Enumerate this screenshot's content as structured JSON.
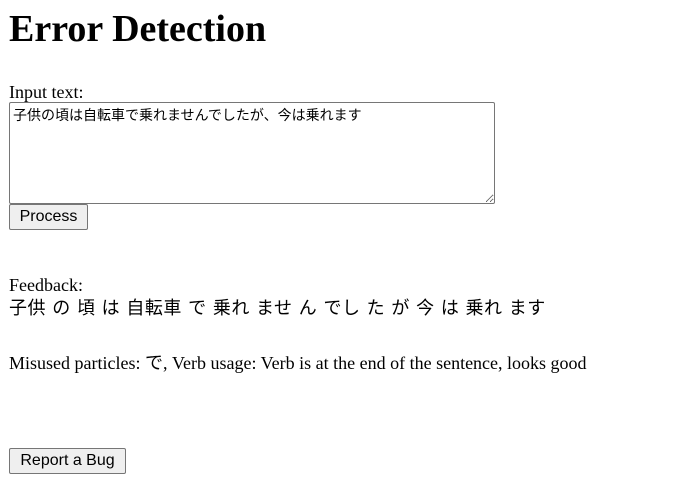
{
  "page": {
    "title": "Error Detection"
  },
  "form": {
    "input_label": "Input text:",
    "input_value": "子供の頃は自転車で乗れませんでしたが、今は乗れます",
    "process_button": "Process"
  },
  "feedback": {
    "label": "Feedback:",
    "tokens": "子供 の 頃 は 自転車 で 乗れ ませ ん でし た が 今 は 乗れ ます",
    "analysis": "Misused particles: で, Verb usage: Verb is at the end of the sentence, looks good"
  },
  "footer": {
    "report_bug_button": "Report a Bug"
  }
}
